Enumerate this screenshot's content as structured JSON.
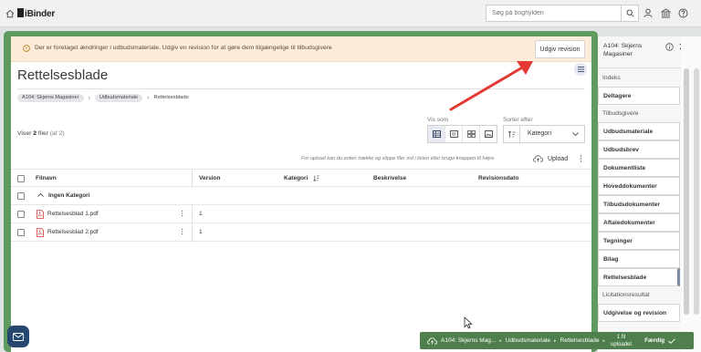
{
  "app": {
    "logo": "iBinder"
  },
  "search": {
    "placeholder": "Søg på boghylden"
  },
  "banner": {
    "message": "Der er foretaget ændringer i udbudsmateriale. Udgiv en revision for at gøre dem tilgængelige til tilbudsgivere",
    "publish_label": "Udgiv revision"
  },
  "page": {
    "title": "Rettelsesblade"
  },
  "breadcrumb": [
    "A104: Skjerns Magasiner",
    "Udbudsmateriale",
    "Rettelsesblade"
  ],
  "view": {
    "label": "Vis som",
    "sort_label": "Sorter efter",
    "sort_value": "Kategori"
  },
  "count": {
    "prefix": "Viser ",
    "num": "2",
    "unit": " filer",
    "of": " (af 2)"
  },
  "upload": {
    "hint": "For upload kan du enten trække og slippe filer ind i listen eller bruge knappen til højre.",
    "label": "Upload"
  },
  "table": {
    "headers": {
      "name": "Filnavn",
      "version": "Version",
      "category": "Kategori",
      "description": "Beskrivelse",
      "revision_date": "Revisionsdato"
    },
    "group": "Ingen Kategori",
    "rows": [
      {
        "name": "Rettelsesblad 1.pdf",
        "version": "1"
      },
      {
        "name": "Rettelsesblad 2.pdf",
        "version": "1"
      }
    ]
  },
  "sidebar": {
    "project": "A104: Skjerns Magasiner",
    "items": [
      {
        "label": "Indeks",
        "type": "sub"
      },
      {
        "label": "Deltagere",
        "type": "sec"
      },
      {
        "label": "Tilbudsgivere",
        "type": "sub"
      },
      {
        "label": "Udbudsmateriale",
        "type": "sec"
      },
      {
        "label": "Udbudsbrev",
        "type": "sec"
      },
      {
        "label": "Dokumentliste",
        "type": "sec"
      },
      {
        "label": "Hoveddokumenter",
        "type": "sec"
      },
      {
        "label": "Tilbudsdokumenter",
        "type": "sec"
      },
      {
        "label": "Aftaledokumenter",
        "type": "sec"
      },
      {
        "label": "Tegninger",
        "type": "sec"
      },
      {
        "label": "Bilag",
        "type": "sec"
      },
      {
        "label": "Rettelsesblade",
        "type": "sec-active"
      },
      {
        "label": "Licitationsresultat",
        "type": "sub"
      },
      {
        "label": "Udgivelse og revision",
        "type": "sec"
      }
    ]
  },
  "status": {
    "project": "A104: Skjerns Mag...",
    "folder": "Udbudsmateriale",
    "subfolder": "Rettelsesblade",
    "count_line1": "1 fil",
    "count_line2": "uploadet",
    "done": "Færdig"
  },
  "colors": {
    "accent_green": "#5f9a5f",
    "banner_bg": "#fcecd9",
    "status_green": "#4e7f4c",
    "arrow_red": "#e53935",
    "chat_navy": "#26476e"
  }
}
